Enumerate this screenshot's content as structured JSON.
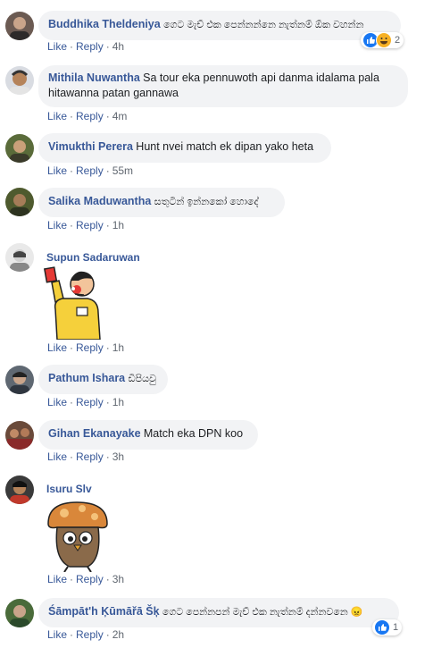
{
  "comments": [
    {
      "author": "Buddhika Theldeniya",
      "text": "ගෙට මැච් එක පෙන්නන්නෙ නැත්නම් ඕක වහන්න",
      "like": "Like",
      "reply": "Reply",
      "time": "4h",
      "reactions": {
        "icons": [
          "like-icon",
          "haha-icon"
        ],
        "count": "2"
      }
    },
    {
      "author": "Mithila Nuwantha",
      "text": "Sa tour eka pennuwoth api danma idalama pala hitawanna patan gannawa",
      "like": "Like",
      "reply": "Reply",
      "time": "4m"
    },
    {
      "author": "Vimukthi Perera",
      "text": "Hunt nvei match ek dipan yako heta",
      "like": "Like",
      "reply": "Reply",
      "time": "55m"
    },
    {
      "author": "Salika Maduwantha",
      "text": "සතුටින් ඉන්නකෝ හොදේ",
      "like": "Like",
      "reply": "Reply",
      "time": "1h"
    },
    {
      "author": "Supun Sadaruwan",
      "sticker": "referee-red-card-sticker",
      "like": "Like",
      "reply": "Reply",
      "time": "1h"
    },
    {
      "author": "Pathum Ishara",
      "text": "ඩිපියවු",
      "like": "Like",
      "reply": "Reply",
      "time": "1h"
    },
    {
      "author": "Gihan Ekanayake",
      "text": "Match eka DPN koo",
      "like": "Like",
      "reply": "Reply",
      "time": "3h"
    },
    {
      "author": "Isuru Slv",
      "sticker": "mushroom-owl-sticker",
      "like": "Like",
      "reply": "Reply",
      "time": "3h"
    },
    {
      "author": "Śāmpāt'h Ķūmāřā Šķ",
      "text": "ගෙට පෙන්නපන් මැච් එක නැත්නම් දන්නවනෙ 😠",
      "like": "Like",
      "reply": "Reply",
      "time": "2h",
      "reactions": {
        "icons": [
          "like-icon"
        ],
        "count": "1"
      }
    }
  ],
  "colors": {
    "link": "#385898",
    "bubble": "#f2f3f5",
    "meta": "#606770",
    "like": "#1877f2",
    "haha": "#f7b125"
  }
}
